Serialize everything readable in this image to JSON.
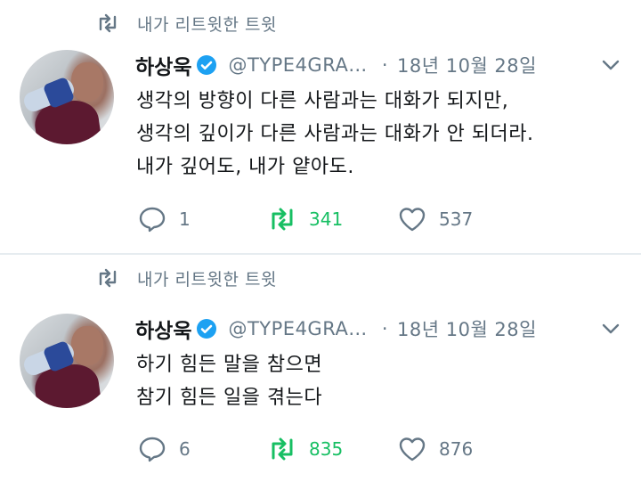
{
  "tweets": [
    {
      "retweet_context": "내가 리트윗한 트윗",
      "author_name": "하상욱",
      "author_handle": "@TYPE4GRA…",
      "separator": "·",
      "timestamp": "18년 10월 28일",
      "lines": [
        "생각의 방향이 다른 사람과는 대화가 되지만,",
        "생각의 깊이가 다른 사람과는 대화가 안 되더라.",
        "내가 깊어도, 내가 얕아도."
      ],
      "reply_count": "1",
      "retweet_count": "341",
      "like_count": "537",
      "retweeted": true
    },
    {
      "retweet_context": "내가 리트윗한 트윗",
      "author_name": "하상욱",
      "author_handle": "@TYPE4GRA…",
      "separator": "·",
      "timestamp": "18년 10월 28일",
      "lines": [
        "하기 힘든 말을 참으면",
        "참기 힘든 일을 겪는다"
      ],
      "reply_count": "6",
      "retweet_count": "835",
      "like_count": "876",
      "retweeted": true
    }
  ],
  "colors": {
    "text_primary": "#14171a",
    "text_secondary": "#657786",
    "retweet_green": "#17bf63",
    "verified_blue": "#1da1f2",
    "divider": "#e6ecf0"
  },
  "icons": {
    "retweet": "retweet-icon",
    "verified": "verified-badge-icon",
    "reply": "reply-icon",
    "like": "heart-icon",
    "more": "chevron-down-icon"
  }
}
